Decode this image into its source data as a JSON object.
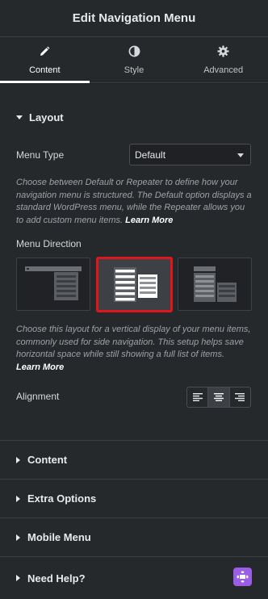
{
  "header": {
    "title": "Edit Navigation Menu"
  },
  "tabs": [
    {
      "label": "Content",
      "icon": "pencil-icon",
      "active": true
    },
    {
      "label": "Style",
      "icon": "contrast-icon",
      "active": false
    },
    {
      "label": "Advanced",
      "icon": "gear-icon",
      "active": false
    }
  ],
  "layout_section": {
    "title": "Layout",
    "menu_type": {
      "label": "Menu Type",
      "value": "Default",
      "help": "Choose between Default or Repeater to define how your navigation menu is structured. The Default option displays a standard WordPress menu, while the Repeater allows you to add custom menu items.",
      "learn_more": "Learn More"
    },
    "menu_direction": {
      "label": "Menu Direction",
      "options": [
        "horizontal-layout",
        "vertical-layout",
        "vertical-dropdown-layout"
      ],
      "selected": "vertical-layout",
      "help": "Choose this layout for a vertical display of your menu items, commonly used for side navigation. This setup helps save horizontal space while still showing a full list of items.",
      "learn_more": "Learn More"
    },
    "alignment": {
      "label": "Alignment",
      "options": [
        "align-left-icon",
        "align-center-icon",
        "align-right-icon"
      ],
      "selected": "align-center-icon"
    }
  },
  "collapsed_sections": [
    {
      "label": "Content"
    },
    {
      "label": "Extra Options"
    },
    {
      "label": "Mobile Menu"
    },
    {
      "label": "Need Help?"
    }
  ],
  "colors": {
    "panel_bg": "#26292c",
    "selected_border": "#e0161b",
    "help_badge": "#9b5de5"
  }
}
